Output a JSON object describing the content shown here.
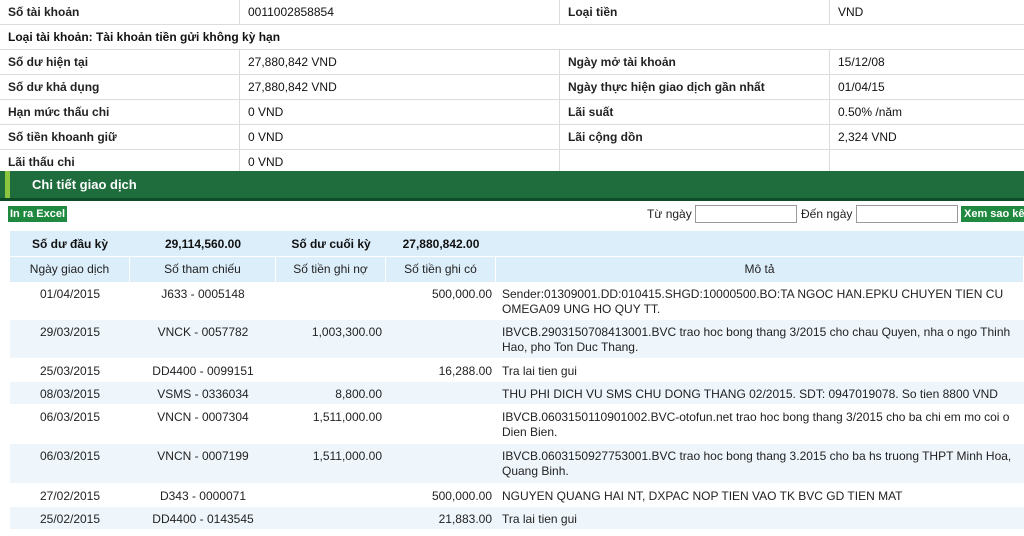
{
  "account": {
    "rows": [
      {
        "l1": "Số tài khoản",
        "v1": "0011002858854",
        "l2": "Loại tiền",
        "v2": "VND"
      },
      {
        "full": "Loại tài khoản: Tài khoản tiền gửi không kỳ hạn"
      },
      {
        "l1": "Số dư hiện tại",
        "v1": "27,880,842 VND",
        "l2": "Ngày mở tài khoản",
        "v2": "15/12/08"
      },
      {
        "l1": "Số dư khả dụng",
        "v1": "27,880,842 VND",
        "l2": "Ngày thực hiện giao dịch gần nhất",
        "v2": "01/04/15"
      },
      {
        "l1": "Hạn mức thấu chi",
        "v1": "0 VND",
        "l2": "Lãi suất",
        "v2": "0.50% /năm"
      },
      {
        "l1": "Số tiền khoanh giữ",
        "v1": "0 VND",
        "l2": "Lãi cộng dồn",
        "v2": "2,324 VND"
      },
      {
        "l1": "Lãi thấu chi",
        "v1": "0 VND",
        "l2": "",
        "v2": ""
      }
    ]
  },
  "section": {
    "title": "Chi tiết giao dịch"
  },
  "toolbar": {
    "excel_label": "In ra Excel",
    "from_label": "Từ ngày",
    "to_label": "Đến ngày",
    "from_value": "",
    "to_value": "",
    "view_label": "Xem sao kê"
  },
  "summary": {
    "open_label": "Số dư đầu kỳ",
    "open_value": "29,114,560.00",
    "close_label": "Số dư cuối kỳ",
    "close_value": "27,880,842.00"
  },
  "table": {
    "headers": [
      "Ngày giao dịch",
      "Số tham chiếu",
      "Số tiền ghi nợ",
      "Số tiền ghi có",
      "Mô tả"
    ],
    "rows": [
      {
        "date": "01/04/2015",
        "ref": "J633 - 0005148",
        "debit": "",
        "credit": "500,000.00",
        "desc": "Sender:01309001.DD:010415.SHGD:10000500.BO:TA NGOC HAN.EPKU CHUYEN TIEN CU OMEGA09 UNG HO QUY TT."
      },
      {
        "date": "29/03/2015",
        "ref": "VNCK - 0057782",
        "debit": "1,003,300.00",
        "credit": "",
        "desc": "IBVCB.2903150708413001.BVC trao hoc bong thang 3/2015 cho chau Quyen, nha o ngo Thinh Hao, pho Ton Duc Thang."
      },
      {
        "date": "25/03/2015",
        "ref": "DD4400 - 0099151",
        "debit": "",
        "credit": "16,288.00",
        "desc": "Tra lai tien gui"
      },
      {
        "date": "08/03/2015",
        "ref": "VSMS - 0336034",
        "debit": "8,800.00",
        "credit": "",
        "desc": "THU PHI DICH VU SMS CHU DONG THANG 02/2015. SDT: 0947019078. So tien 8800 VND"
      },
      {
        "date": "06/03/2015",
        "ref": "VNCN - 0007304",
        "debit": "1,511,000.00",
        "credit": "",
        "desc": "IBVCB.0603150110901002.BVC-otofun.net trao hoc bong thang 3/2015 cho ba chi em mo coi o Dien Bien."
      },
      {
        "date": "06/03/2015",
        "ref": "VNCN - 0007199",
        "debit": "1,511,000.00",
        "credit": "",
        "desc": "IBVCB.0603150927753001.BVC trao hoc bong thang 3.2015 cho ba hs truong THPT Minh Hoa, Quang Binh."
      },
      {
        "date": "27/02/2015",
        "ref": "D343 - 0000071",
        "debit": "",
        "credit": "500,000.00",
        "desc": "NGUYEN QUANG HAI NT, DXPAC NOP TIEN VAO TK BVC GD TIEN MAT"
      },
      {
        "date": "25/02/2015",
        "ref": "DD4400 - 0143545",
        "debit": "",
        "credit": "21,883.00",
        "desc": "Tra lai tien gui"
      }
    ]
  }
}
